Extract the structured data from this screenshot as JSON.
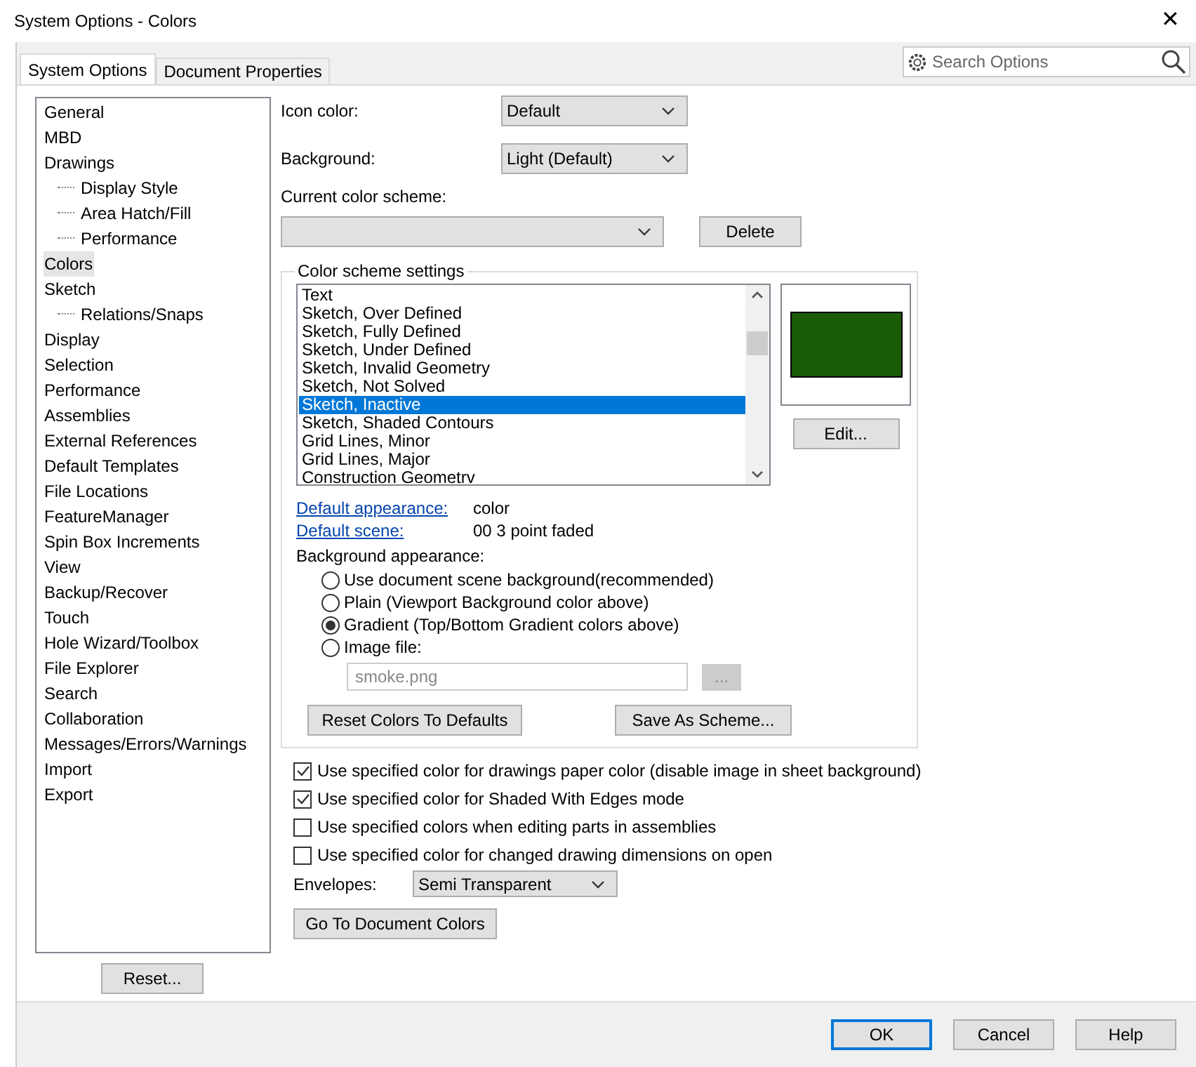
{
  "window": {
    "title": "System Options - Colors",
    "close": "✕"
  },
  "tabs": [
    {
      "label": "System Options",
      "selected": true
    },
    {
      "label": "Document Properties",
      "selected": false
    }
  ],
  "search": {
    "placeholder": "Search Options"
  },
  "tree": [
    {
      "label": "General",
      "selected": false
    },
    {
      "label": "MBD",
      "selected": false
    },
    {
      "label": "Drawings",
      "selected": false,
      "children": [
        {
          "label": "Display Style",
          "selected": false
        },
        {
          "label": "Area Hatch/Fill",
          "selected": false
        },
        {
          "label": "Performance",
          "selected": false
        }
      ]
    },
    {
      "label": "Colors",
      "selected": true
    },
    {
      "label": "Sketch",
      "selected": false,
      "children": [
        {
          "label": "Relations/Snaps",
          "selected": false
        }
      ]
    },
    {
      "label": "Display",
      "selected": false
    },
    {
      "label": "Selection",
      "selected": false
    },
    {
      "label": "Performance",
      "selected": false
    },
    {
      "label": "Assemblies",
      "selected": false
    },
    {
      "label": "External References",
      "selected": false
    },
    {
      "label": "Default Templates",
      "selected": false
    },
    {
      "label": "File Locations",
      "selected": false
    },
    {
      "label": "FeatureManager",
      "selected": false
    },
    {
      "label": "Spin Box Increments",
      "selected": false
    },
    {
      "label": "View",
      "selected": false
    },
    {
      "label": "Backup/Recover",
      "selected": false
    },
    {
      "label": "Touch",
      "selected": false
    },
    {
      "label": "Hole Wizard/Toolbox",
      "selected": false
    },
    {
      "label": "File Explorer",
      "selected": false
    },
    {
      "label": "Search",
      "selected": false
    },
    {
      "label": "Collaboration",
      "selected": false
    },
    {
      "label": "Messages/Errors/Warnings",
      "selected": false
    },
    {
      "label": "Import",
      "selected": false
    },
    {
      "label": "Export",
      "selected": false
    }
  ],
  "reset_button": "Reset...",
  "icon_color": {
    "label": "Icon color:",
    "value": "Default"
  },
  "background": {
    "label": "Background:",
    "value": "Light (Default)"
  },
  "current_scheme": {
    "label": "Current color scheme:",
    "delete_button": "Delete"
  },
  "scheme_settings": {
    "title": "Color scheme settings",
    "items": [
      {
        "label": "Text",
        "selected": false
      },
      {
        "label": "Sketch, Over Defined",
        "selected": false
      },
      {
        "label": "Sketch, Fully Defined",
        "selected": false
      },
      {
        "label": "Sketch, Under Defined",
        "selected": false
      },
      {
        "label": "Sketch, Invalid Geometry",
        "selected": false
      },
      {
        "label": "Sketch, Not Solved",
        "selected": false
      },
      {
        "label": "Sketch, Inactive",
        "selected": true
      },
      {
        "label": "Sketch, Shaded Contours",
        "selected": false
      },
      {
        "label": "Grid Lines, Minor",
        "selected": false
      },
      {
        "label": "Grid Lines, Major",
        "selected": false
      },
      {
        "label": "Construction Geometrv",
        "selected": false
      }
    ],
    "swatch": {
      "color": "#1a5c06"
    },
    "edit_button": "Edit...",
    "default_appearance": {
      "label": "Default appearance:",
      "value": "color"
    },
    "default_scene": {
      "label": "Default scene:",
      "value": "00 3 point faded"
    },
    "background_appearance": "Background appearance:",
    "radios": [
      {
        "label": "Use document scene background(recommended)",
        "selected": false
      },
      {
        "label": "Plain (Viewport Background color above)",
        "selected": false
      },
      {
        "label": "Gradient (Top/Bottom Gradient colors above)",
        "selected": true
      },
      {
        "label": "Image file:",
        "selected": false
      }
    ],
    "image_file": "smoke.png",
    "browse_button": "...",
    "reset_colors_button": "Reset Colors To Defaults",
    "save_scheme_button": "Save As Scheme..."
  },
  "checkboxes": [
    {
      "label": "Use specified color for drawings paper color (disable image in sheet background)",
      "checked": true
    },
    {
      "label": "Use specified color for Shaded With Edges mode",
      "checked": true
    },
    {
      "label": "Use specified colors when editing parts in assemblies",
      "checked": false
    },
    {
      "label": "Use specified color for changed drawing dimensions on open",
      "checked": false
    }
  ],
  "envelopes": {
    "label": "Envelopes:",
    "value": "Semi Transparent"
  },
  "document_colors_button": "Go To Document Colors",
  "buttons": [
    {
      "label": "OK",
      "default": true
    },
    {
      "label": "Cancel",
      "default": false
    },
    {
      "label": "Help",
      "default": false
    }
  ]
}
